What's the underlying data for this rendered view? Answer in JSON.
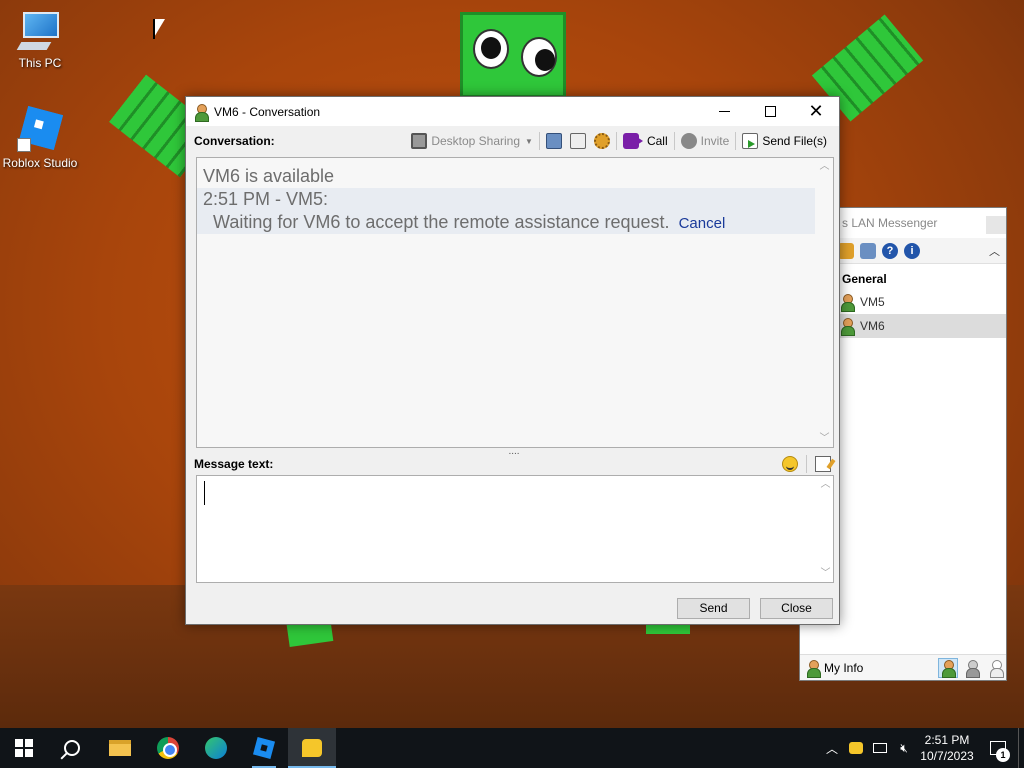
{
  "desktop": {
    "icons": [
      {
        "label": "This PC",
        "icon": "computer-icon"
      },
      {
        "label": "Roblox Studio",
        "icon": "roblox-studio-icon"
      }
    ]
  },
  "bg_window": {
    "title": "s LAN Messenger",
    "group": "General",
    "contacts": [
      {
        "name": "VM5",
        "selected": false
      },
      {
        "name": "VM6",
        "selected": true
      }
    ],
    "my_info": "My Info"
  },
  "conversation": {
    "title": "VM6 - Conversation",
    "conversation_label": "Conversation:",
    "toolbar": {
      "desktop_sharing": "Desktop Sharing",
      "call": "Call",
      "invite": "Invite",
      "send_files": "Send File(s)"
    },
    "log": {
      "status": "VM6 is available",
      "header": "2:51 PM - VM5:",
      "message": "Waiting for VM6 to accept the remote assistance request.",
      "link": "Cancel"
    },
    "message_label": "Message text:",
    "message_value": "",
    "send_button": "Send",
    "close_button": "Close"
  },
  "taskbar": {
    "apps": [
      "start-icon",
      "search-icon",
      "file-explorer-icon",
      "chrome-icon",
      "edge-icon",
      "roblox-icon",
      "lan-messenger-icon"
    ],
    "clock_time": "2:51 PM",
    "clock_date": "10/7/2023",
    "notification_count": "1"
  },
  "colors": {
    "accent": "#1a3a9a",
    "taskbar_bg": "#101418",
    "wallpaper": "#a8450c"
  }
}
